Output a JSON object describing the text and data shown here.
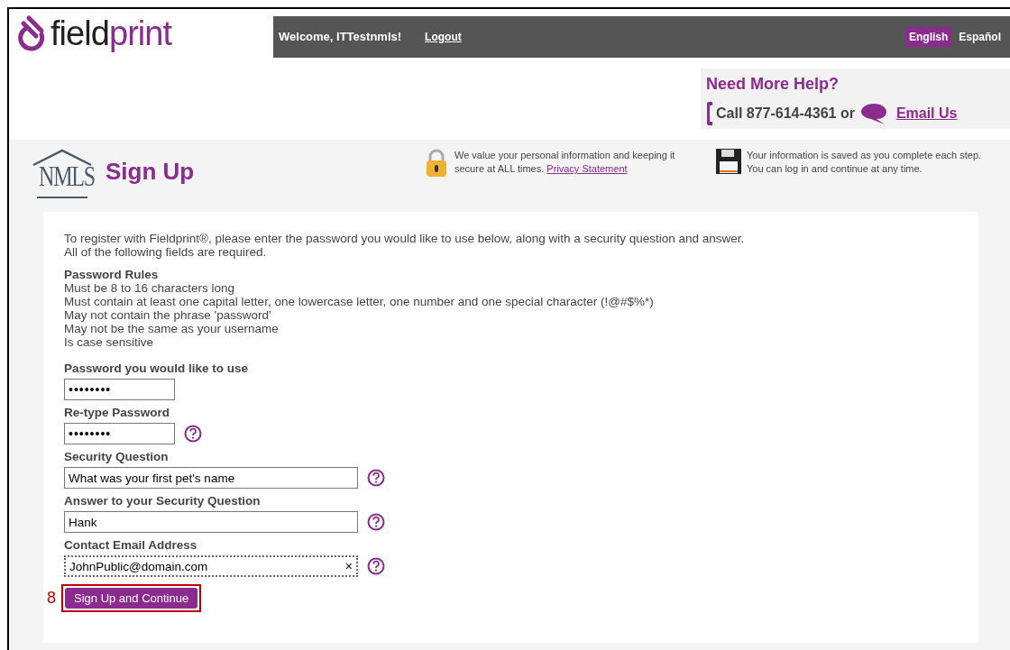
{
  "header": {
    "logo": [
      "field",
      "print"
    ],
    "welcome": "Welcome, ITTestnmls!",
    "logout": "Logout",
    "languages": [
      {
        "label": "English",
        "selected": true
      },
      {
        "label": "Español",
        "selected": false
      }
    ]
  },
  "help": {
    "title": "Need More Help?",
    "call": "Call 877-614-4361 or",
    "email": "Email Us"
  },
  "banner": {
    "logo": "NMLS",
    "title": "Sign Up",
    "security_note": "We value your personal information and keeping it secure at ALL times.",
    "privacy_link": "Privacy Statement",
    "save_note": "Your information is saved as you complete each step. You can log in and continue at any time."
  },
  "intro": [
    "To register with Fieldprint®, please enter the password you would like to use below, along with a security question and answer.",
    "All of the following fields are required."
  ],
  "rules": {
    "title": "Password Rules",
    "items": [
      "Must be 8 to 16 characters long",
      "Must contain at least one capital letter, one lowercase letter, one number and one special character (!@#$%*)",
      "May not contain the phrase 'password'",
      "May not be the same as your username",
      "Is case sensitive"
    ]
  },
  "fields": [
    {
      "label": "Password you would like to use",
      "value": "••••••••",
      "kind": "short",
      "help": false,
      "focused": false
    },
    {
      "label": "Re-type Password",
      "value": "••••••••",
      "kind": "short",
      "help": true,
      "focused": false
    },
    {
      "label": "Security Question",
      "value": "What was your first pet's name",
      "kind": "long",
      "help": true,
      "focused": false
    },
    {
      "label": "Answer to your Security Question",
      "value": "Hank",
      "kind": "long",
      "help": true,
      "focused": false
    },
    {
      "label": "Contact Email Address",
      "value": "JohnPublic@domain.com",
      "kind": "long",
      "help": true,
      "focused": true,
      "clear": "×"
    }
  ],
  "step": "8",
  "submit": "Sign Up and Continue"
}
